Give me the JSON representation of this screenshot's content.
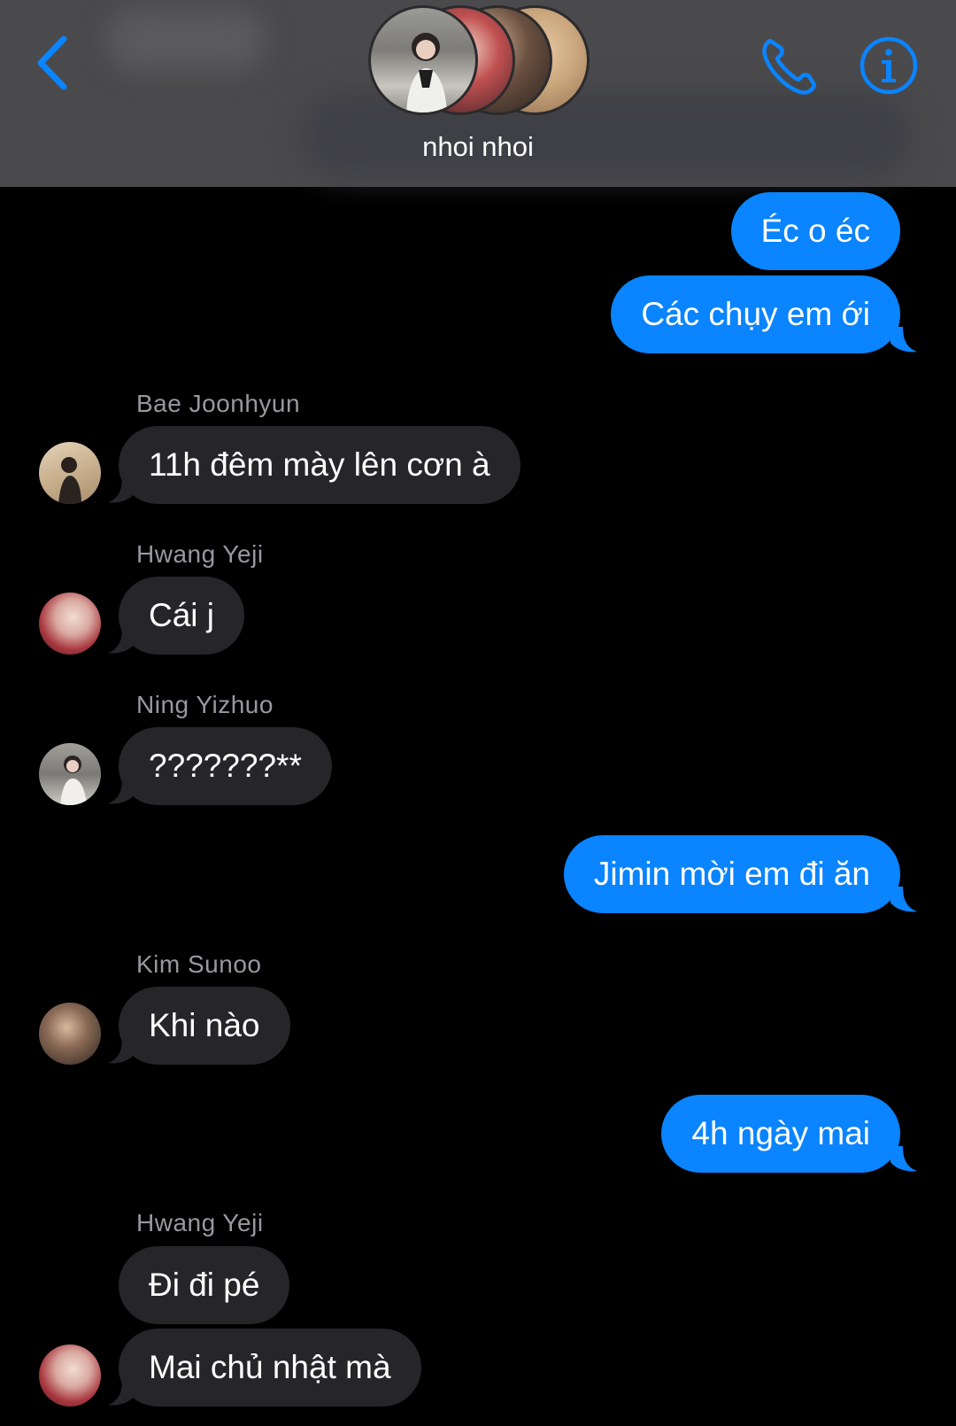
{
  "header": {
    "title": "nhoi nhoi",
    "back_icon": "chevron-left-icon",
    "call_icon": "phone-icon",
    "info_icon": "info-icon",
    "accent_color": "#0a84ff"
  },
  "messages": [
    {
      "direction": "outgoing",
      "text": "Éc o éc"
    },
    {
      "direction": "outgoing",
      "text": "Các chụy em ới"
    },
    {
      "direction": "incoming",
      "sender": "Bae Joonhyun",
      "text": "11h đêm mày lên cơn à"
    },
    {
      "direction": "incoming",
      "sender": "Hwang Yeji",
      "text": "Cái j"
    },
    {
      "direction": "incoming",
      "sender": "Ning Yizhuo",
      "text": "???????**"
    },
    {
      "direction": "outgoing",
      "text": "Jimin mời em đi ăn"
    },
    {
      "direction": "incoming",
      "sender": "Kim Sunoo",
      "text": "Khi nào"
    },
    {
      "direction": "outgoing",
      "text": "4h ngày mai"
    },
    {
      "direction": "incoming",
      "sender": "Hwang Yeji",
      "text": "Đi đi pé"
    },
    {
      "direction": "incoming",
      "text": "Mai chủ nhật mà"
    }
  ],
  "colors": {
    "outgoing_bubble": "#0a84ff",
    "incoming_bubble": "#262629",
    "background": "#000000"
  }
}
